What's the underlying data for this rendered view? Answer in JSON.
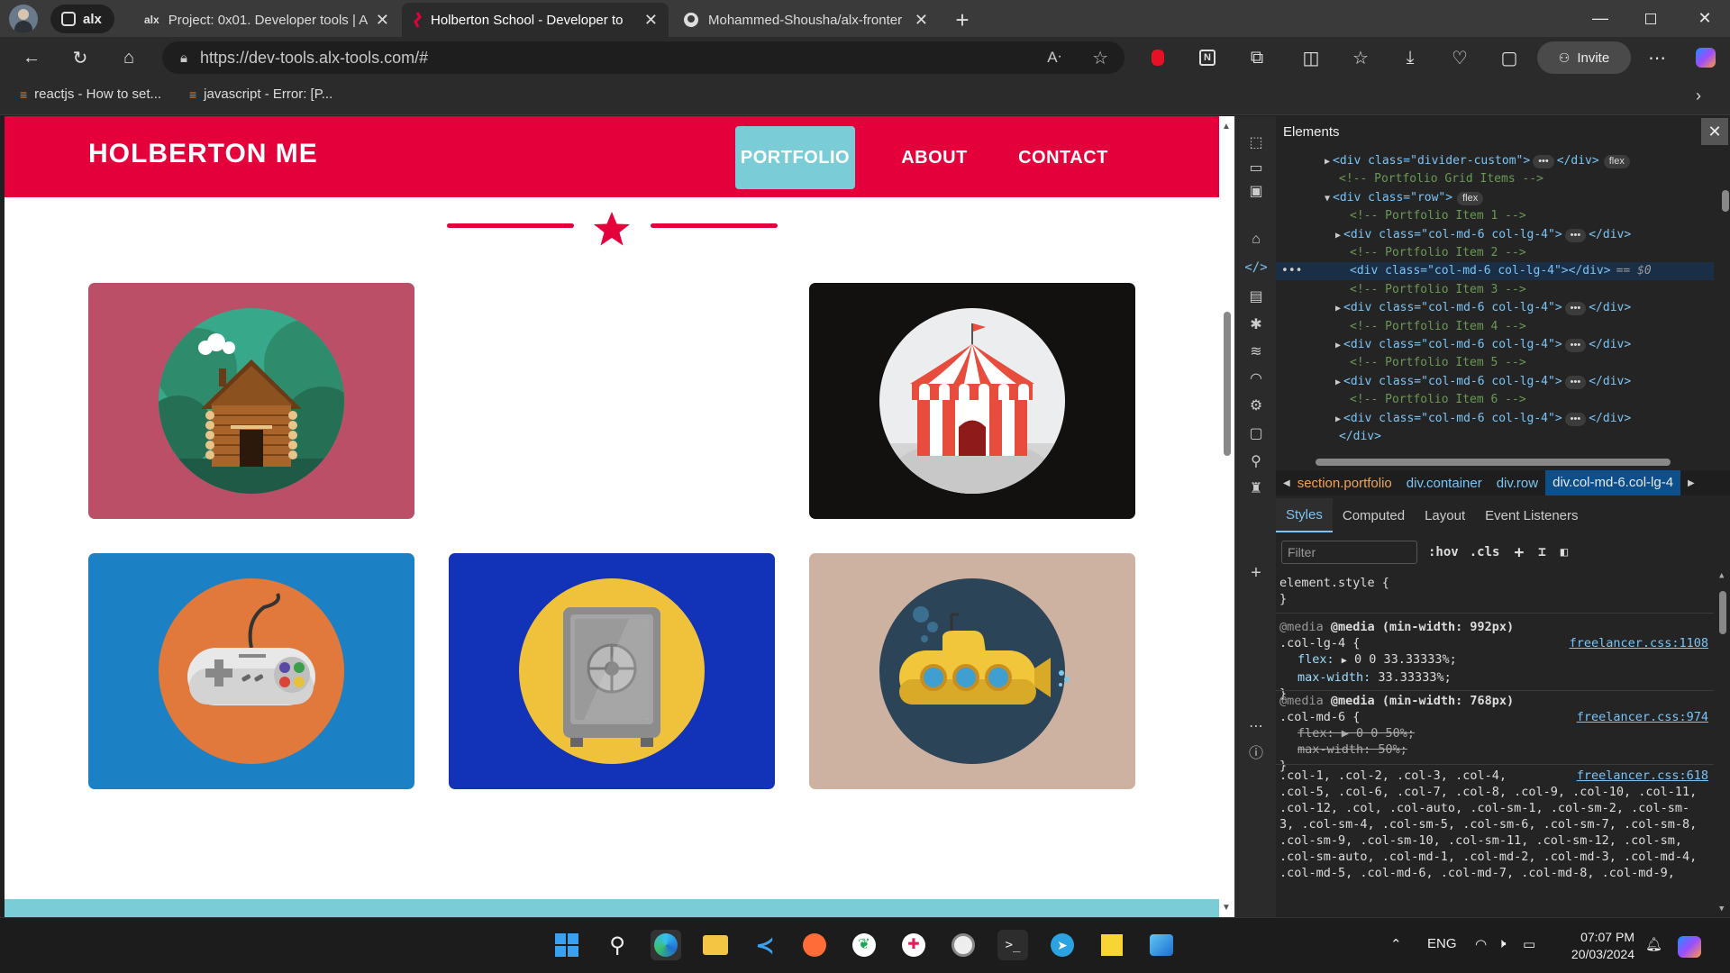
{
  "browser": {
    "group_label": "alx",
    "tabs": [
      {
        "label": "Project: 0x01. Developer tools | A",
        "active": false
      },
      {
        "label": "Holberton School - Developer to",
        "active": true
      },
      {
        "label": "Mohammed-Shousha/alx-fronter",
        "active": false
      }
    ],
    "new_tab": "+",
    "url": "https://dev-tools.alx-tools.com/#",
    "invite_label": "Invite",
    "bookmarks": [
      {
        "label": "reactjs - How to set..."
      },
      {
        "label": "javascript - Error: [P..."
      }
    ]
  },
  "site": {
    "brand": "HOLBERTON ME",
    "nav": [
      {
        "label": "PORTFOLIO",
        "active": true
      },
      {
        "label": "ABOUT",
        "active": false
      },
      {
        "label": "CONTACT",
        "active": false
      }
    ],
    "colors": {
      "primary": "#e4003b",
      "accent": "#7accd6"
    },
    "portfolio_items": [
      {
        "icon": "cabin-icon",
        "bg": "#bb4f68"
      },
      {
        "icon": "circus-tent-icon",
        "bg": "#131010"
      },
      {
        "icon": "game-controller-icon",
        "bg": "#1c80c5"
      },
      {
        "icon": "safe-icon",
        "bg": "#1232b8"
      },
      {
        "icon": "submarine-icon",
        "bg": "#cdb1a1"
      }
    ]
  },
  "devtools": {
    "title": "Elements",
    "tree": [
      {
        "indent": 1,
        "kind": "element",
        "open": false,
        "text": "<div class=\"divider-custom\">",
        "ellipsis": true,
        "close": "</div>",
        "badge": "flex"
      },
      {
        "indent": 1,
        "kind": "comment",
        "text": "<!-- Portfolio Grid Items -->"
      },
      {
        "indent": 1,
        "kind": "element",
        "open": true,
        "text": "<div class=\"row\">",
        "badge": "flex"
      },
      {
        "indent": 2,
        "kind": "comment",
        "text": "<!-- Portfolio Item 1 -->"
      },
      {
        "indent": 2,
        "kind": "element",
        "open": false,
        "text": "<div class=\"col-md-6 col-lg-4\">",
        "ellipsis": true,
        "close": "</div>"
      },
      {
        "indent": 2,
        "kind": "comment",
        "text": "<!-- Portfolio Item 2 -->"
      },
      {
        "indent": 2,
        "kind": "selected",
        "text": "<div class=\"col-md-6 col-lg-4\"></div>",
        "suffix": "== $0"
      },
      {
        "indent": 2,
        "kind": "comment",
        "text": "<!-- Portfolio Item 3 -->"
      },
      {
        "indent": 2,
        "kind": "element",
        "open": false,
        "text": "<div class=\"col-md-6 col-lg-4\">",
        "ellipsis": true,
        "close": "</div>"
      },
      {
        "indent": 2,
        "kind": "comment",
        "text": "<!-- Portfolio Item 4 -->"
      },
      {
        "indent": 2,
        "kind": "element",
        "open": false,
        "text": "<div class=\"col-md-6 col-lg-4\">",
        "ellipsis": true,
        "close": "</div>"
      },
      {
        "indent": 2,
        "kind": "comment",
        "text": "<!-- Portfolio Item 5 -->"
      },
      {
        "indent": 2,
        "kind": "element",
        "open": false,
        "text": "<div class=\"col-md-6 col-lg-4\">",
        "ellipsis": true,
        "close": "</div>"
      },
      {
        "indent": 2,
        "kind": "comment",
        "text": "<!-- Portfolio Item 6 -->"
      },
      {
        "indent": 2,
        "kind": "element",
        "open": false,
        "text": "<div class=\"col-md-6 col-lg-4\">",
        "ellipsis": true,
        "close": "</div>"
      },
      {
        "indent": 1,
        "kind": "closing",
        "text": "</div>"
      }
    ],
    "breadcrumbs": [
      "section.portfolio",
      "div.container",
      "div.row",
      "div.col-md-6.col-lg-4"
    ],
    "style_tabs": [
      "Styles",
      "Computed",
      "Layout",
      "Event Listeners"
    ],
    "filter_placeholder": "Filter",
    "hov": ":hov",
    "cls": ".cls",
    "rules": {
      "element_style_open": "element.style {",
      "close": "}",
      "r1_media": "@media (min-width: 992px)",
      "r1_selector": ".col-lg-4 {",
      "r1_src": "freelancer.css:1108",
      "r1_p1_name": "flex:",
      "r1_p1_val": "0 0 33.33333%;",
      "r1_p2_name": "max-width:",
      "r1_p2_val": "33.33333%;",
      "r2_media": "@media (min-width: 768px)",
      "r2_selector": ".col-md-6 {",
      "r2_src": "freelancer.css:974",
      "r2_p1": "flex: ▶ 0 0 50%;",
      "r2_p2": "max-width: 50%;",
      "r3_src": "freelancer.css:618",
      "r3_lines": [
        ".col-1, .col-2, .col-3, .col-4,",
        ".col-5, .col-6, .col-7, .col-8, .col-9, .col-10, .col-11,",
        ".col-12, .col, .col-auto, .col-sm-1, .col-sm-2, .col-sm-",
        "3, .col-sm-4, .col-sm-5, .col-sm-6, .col-sm-7, .col-sm-8,",
        ".col-sm-9, .col-sm-10, .col-sm-11, .col-sm-12, .col-sm,",
        ".col-sm-auto, .col-md-1, .col-md-2, .col-md-3, .col-md-4,",
        ".col-md-5, .col-md-6, .col-md-7, .col-md-8, .col-md-9,"
      ]
    }
  },
  "taskbar": {
    "language": "ENG",
    "time": "07:07 PM",
    "date": "20/03/2024"
  }
}
